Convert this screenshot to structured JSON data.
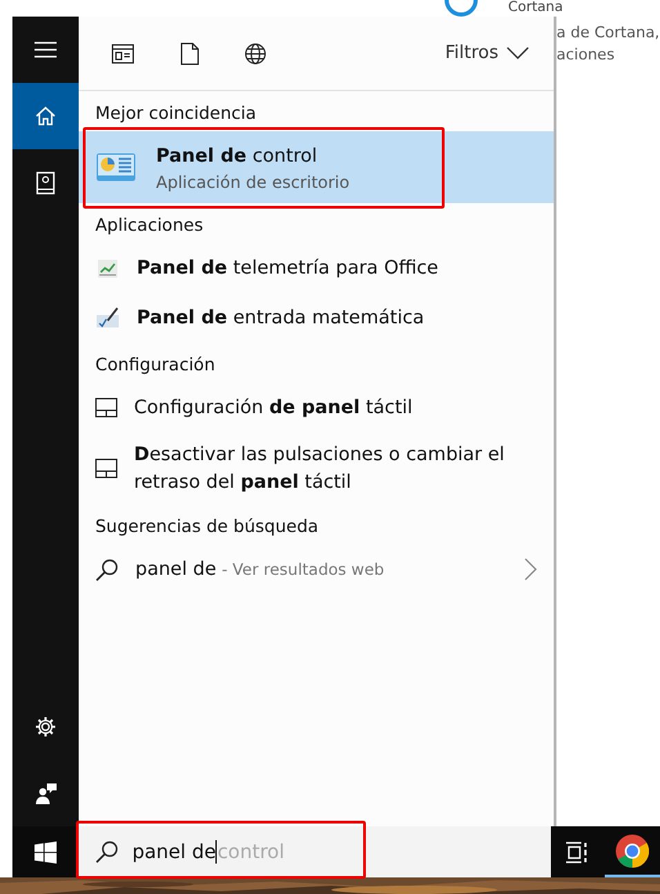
{
  "background_window": {
    "title": "Cortana",
    "lines": [
      "a de Cortana,",
      "aciones"
    ]
  },
  "sidebar": {
    "items": [
      {
        "kind": "home",
        "selected": true
      },
      {
        "kind": "book",
        "selected": false
      }
    ],
    "bottom": [
      {
        "kind": "settings"
      },
      {
        "kind": "feedback"
      }
    ]
  },
  "filters": {
    "label": "Filtros"
  },
  "sections": [
    {
      "title": "Mejor coincidencia",
      "items": [
        {
          "kind": "control-panel",
          "text": "**Panel de** control",
          "subtitle": "Aplicación de escritorio",
          "selected": true,
          "annotated": true
        }
      ]
    },
    {
      "title": "Aplicaciones",
      "items": [
        {
          "kind": "chart",
          "text": "**Panel de** telemetría para Office",
          "selected": false,
          "annotated": false
        },
        {
          "kind": "math",
          "text": "**Panel de** entrada matemática",
          "selected": false,
          "annotated": false
        }
      ]
    },
    {
      "title": "Configuración",
      "items": [
        {
          "kind": "touchpad",
          "text": "Configuración **de panel** táctil",
          "selected": false,
          "annotated": false
        },
        {
          "kind": "touchpad",
          "text": "**D**esactivar las pulsaciones o cambiar el retraso del **panel** táctil",
          "selected": false,
          "annotated": false
        }
      ]
    },
    {
      "title": "Sugerencias de búsqueda",
      "items": [
        {
          "kind": "web",
          "text": "panel de",
          "subtitle": "- Ver resultados web",
          "selected": false,
          "annotated": false
        }
      ]
    }
  ],
  "search": {
    "value": "panel de",
    "suggestion": "control",
    "annotated": true
  }
}
